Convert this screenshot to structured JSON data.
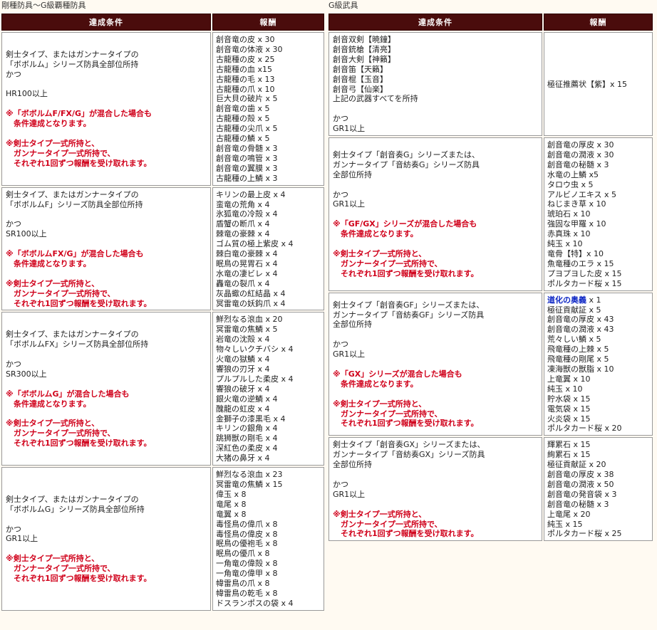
{
  "left": {
    "title": "剛種防具～G級覇種防具",
    "headers": [
      "達成条件",
      "報酬"
    ],
    "rows": [
      {
        "cond": [
          "剣士タイプ、またはガンナータイプの",
          "「ボボルム」シリーズ防具全部位所持",
          "かつ",
          "",
          "HR100以上",
          "",
          "※「ボボルムF/FX/G」が混合した場合も",
          "　条件達成となります。",
          "",
          "※剣士タイプ一式所持と、",
          "　ガンナータイプ一式所持で、",
          "　それぞれ1回ずつ報酬を受け取れます。"
        ],
        "warn": [
          6,
          7,
          9,
          10,
          11
        ],
        "reward": [
          "創音竜の皮 x 30",
          "創音竜の体液 x 30",
          "古龍種の皮 x 25",
          "古龍種の血 x15",
          "古龍種の毛 x 13",
          "古龍種の爪 x 10",
          "巨大貝の破片 x 5",
          "創音竜の歯 x 5",
          "古龍種の殻 x 5",
          "古龍種の尖爪 x 5",
          "古龍種の鱗 x 5",
          "創音竜の骨髄 x 3",
          "創音竜の鳴管 x 3",
          "創音竜の翼膜 x 3",
          "古龍種の上鱗 x 3"
        ]
      },
      {
        "cond": [
          "剣士タイプ、またはガンナータイプの",
          "「ボボルムF」シリーズ防具全部位所持",
          "",
          "かつ",
          "SR100以上",
          "",
          "※「ボボルムFX/G」が混合した場合も",
          "　条件達成となります。",
          "",
          "※剣士タイプ一式所持と、",
          "　ガンナータイプ一式所持で、",
          "　それぞれ1回ずつ報酬を受け取れます。"
        ],
        "warn": [
          6,
          7,
          9,
          10,
          11
        ],
        "reward": [
          "キリンの最上皮 x 4",
          "蛮竜の荒角 x 4",
          "氷狐竜の冷殻 x 4",
          "盾蟹の断爪 x 4",
          "棘竜の豪棘 x 4",
          "ゴム質の極上紫皮 x 4",
          "棘白竜の豪棘 x 4",
          "眠鳥の晃胃石 x 4",
          "水竜の凄ビレ x 4",
          "轟竜の裂爪 x 4",
          "灰晶蠍の紅結晶 x 4",
          "冥雷竜の妖鈎爪 x 4"
        ]
      },
      {
        "cond": [
          "剣士タイプ、またはガンナータイプの",
          "「ボボルムFX」シリーズ防具全部位所持",
          "",
          "かつ",
          "SR300以上",
          "",
          "※「ボボルムG」が混合した場合も",
          "　条件達成となります。",
          "",
          "※剣士タイプ一式所持と、",
          "　ガンナータイプ一式所持で、",
          "　それぞれ1回ずつ報酬を受け取れます。"
        ],
        "warn": [
          6,
          7,
          9,
          10,
          11
        ],
        "reward": [
          "鮮烈なる滾血 x 20",
          "冥雷竜の焦鱗 x 5",
          "岩竜の沈殻 x 4",
          "物々しいクチバシ x 4",
          "火竜の獄鱗 x 4",
          "響狼の刃牙 x 4",
          "プルプルした柔皮 x 4",
          "響狼の破牙 x 4",
          "銀火竜の逆鱗 x 4",
          "醜龍の虹皮 x 4",
          "金獅子の漆黒毛 x 4",
          "キリンの銀角 x 4",
          "跳狮獣の剛毛 x 4",
          "深紅色の柔皮 x 4",
          "大猪の鼻牙 x 4"
        ]
      },
      {
        "cond": [
          "剣士タイプ、またはガンナータイプの",
          "「ボボルムG」シリーズ防具全部位所持",
          "",
          "かつ",
          "GR1以上",
          "",
          "※剣士タイプ一式所持と、",
          "　ガンナータイプ一式所持で、",
          "　それぞれ1回ずつ報酬を受け取れます。"
        ],
        "warn": [
          6,
          7,
          8
        ],
        "reward": [
          "鮮烈なる滾血 x 23",
          "冥雷竜の焦鱗 x 15",
          "偉玉 x 8",
          "竜尾 x 8",
          "竜翼 x 8",
          "毒怪鳥の偉爪 x 8",
          "毒怪鳥の偉皮 x 8",
          "眠鳥の優袍毛 x 8",
          "眠鳥の優爪 x 8",
          "一角竜の偉殻 x 8",
          "一角竜の偉甲 x 8",
          "幃雷鳥の爪 x 8",
          "幃雷鳥の乾毛 x 8",
          "ドスランポスの袋 x 4"
        ]
      }
    ]
  },
  "right": {
    "title": "G級武具",
    "headers": [
      "達成条件",
      "報酬"
    ],
    "rows": [
      {
        "cond": [
          "創音双剣【暁鐘】",
          "創音銃槍【清亮】",
          "創音大剣【神籟】",
          "創音笛【天籟】",
          "創音棍【玉音】",
          "創音弓【仙楽】",
          "上記の武器すべてを所持",
          "",
          "かつ",
          "GR1以上"
        ],
        "warn": [],
        "reward": [
          "極征推薦状【紫】x 15"
        ],
        "reward_middle": true
      },
      {
        "cond": [
          "剣士タイプ「創音奏G」シリーズまたは、",
          "ガンナータイプ「音紡奏G」シリーズ防具",
          "全部位所持",
          "",
          "かつ",
          "GR1以上",
          "",
          "※「GF/GX」シリーズが混合した場合も",
          "　条件達成となります。",
          "",
          "※剣士タイプ一式所持と、",
          "　ガンナータイプ一式所持で、",
          "　それぞれ1回ずつ報酬を受け取れます。"
        ],
        "warn": [
          7,
          8,
          10,
          11,
          12
        ],
        "reward": [
          "創音竜の厚皮 x 30",
          "創音竜の潤液 x 30",
          "創音竜の秘髄 x 3",
          "水竜の上鱗 x5",
          "タロウ虫 x 5",
          "アルビノエキス x 5",
          "ねじまき草 x 10",
          "琥珀石 x 10",
          "強固な甲羅 x 10",
          "赤真珠 x 10",
          "純玉 x 10",
          "竜骨【特】x 10",
          "魚竜種のエラ x 15",
          "プヨプヨした皮 x 15",
          "ポルタカード桜 x 15"
        ]
      },
      {
        "cond": [
          "剣士タイプ「創音奏GF」シリーズまたは、",
          "ガンナータイプ「音紡奏GF」シリーズ防具",
          "全部位所持",
          "",
          "かつ",
          "GR1以上",
          "",
          "※「GX」シリーズが混合した場合も",
          "　条件達成となります。",
          "",
          "※剣士タイプ一式所持と、",
          "　ガンナータイプ一式所持で、",
          "　それぞれ1回ずつ報酬を受け取れます。"
        ],
        "warn": [
          7,
          8,
          10,
          11,
          12
        ],
        "reward": [
          "道化の奥義 x 1",
          "極征貢献証 x 5",
          "創音竜の厚皮 x 43",
          "創音竜の潤液 x 43",
          "荒々しい鱗 x 5",
          "飛竜種の上棘 x 5",
          "飛竜種の剛尾 x 5",
          "凍海獣の獣脂 x 10",
          "上竜翼 x 10",
          "純玉 x 10",
          "貯水袋 x 15",
          "電気袋 x 15",
          "火炎袋 x 15",
          "ポルタカード桜 x 20"
        ],
        "reward_blue_first": true
      },
      {
        "cond": [
          "剣士タイプ「創音奏GX」シリーズまたは、",
          "ガンナータイプ「音紡奏GX」シリーズ防具",
          "全部位所持",
          "",
          "かつ",
          "GR1以上",
          "",
          "※剣士タイプ一式所持と、",
          "　ガンナータイプ一式所持で、",
          "　それぞれ1回ずつ報酬を受け取れます。"
        ],
        "warn": [
          7,
          8,
          9
        ],
        "reward": [
          "輝累石 x 15",
          "絢累石 x 15",
          "極征貢献証 x 20",
          "創音竜の厚皮 x 38",
          "創音竜の潤液 x 50",
          "創音竜の発音袋 x 3",
          "創音竜の秘髄 x 3",
          "上竜尾 x 20",
          "純玉 x 15",
          "ポルタカード桜 x 25"
        ]
      }
    ]
  }
}
